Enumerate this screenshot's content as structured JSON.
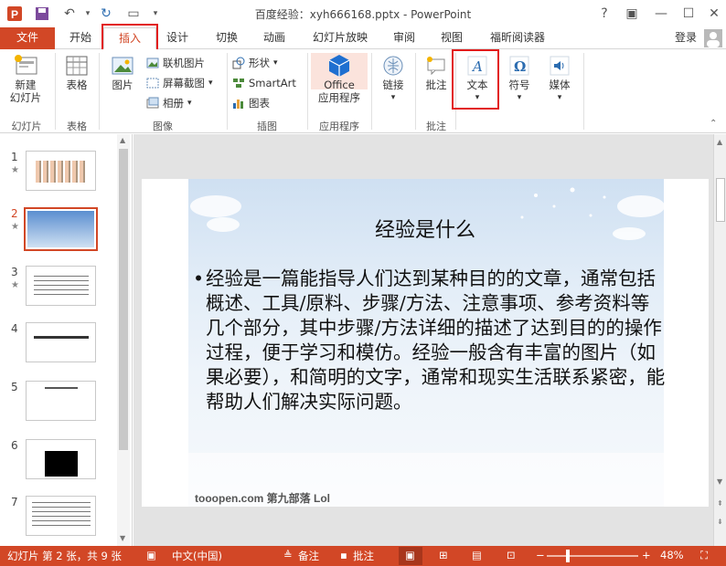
{
  "titlebar": {
    "title": "百度经验：xyh666168.pptx - PowerPoint",
    "help": "?",
    "minimize": "—",
    "close": "✕"
  },
  "tabs": {
    "file": "文件",
    "home": "开始",
    "insert": "插入",
    "design": "设计",
    "transitions": "切换",
    "animations": "动画",
    "slideshow": "幻灯片放映",
    "review": "审阅",
    "view": "视图",
    "foxit": "福昕阅读器",
    "login": "登录"
  },
  "ribbon": {
    "new_slide": "新建",
    "new_slide_2": "幻灯片",
    "table": "表格",
    "picture": "图片",
    "online_picture": "联机图片",
    "screenshot": "屏幕截图",
    "album": "相册",
    "shapes": "形状",
    "smartart": "SmartArt",
    "chart": "图表",
    "office_apps": "Office",
    "office_apps_2": "应用程序",
    "links": "链接",
    "comment": "批注",
    "text": "文本",
    "symbols": "符号",
    "media": "媒体",
    "groups": {
      "slides": "幻灯片",
      "tables": "表格",
      "images": "图像",
      "illustrations": "插图",
      "apps": "应用程序",
      "comments": "批注"
    }
  },
  "thumbnails": [
    {
      "num": "1",
      "star": "★"
    },
    {
      "num": "2",
      "star": "★"
    },
    {
      "num": "3",
      "star": "★"
    },
    {
      "num": "4",
      "star": ""
    },
    {
      "num": "5",
      "star": ""
    },
    {
      "num": "6",
      "star": ""
    },
    {
      "num": "7",
      "star": ""
    }
  ],
  "slide": {
    "title": "经验是什么",
    "body": "经验是一篇能指导人们达到某种目的的文章，通常包括概述、工具/原料、步骤/方法、注意事项、参考资料等几个部分，其中步骤/方法详细的描述了达到目的的操作过程，便于学习和模仿。经验一般含有丰富的图片（如果必要），和简明的文字，通常和现实生活联系紧密，能帮助人们解决实际问题。",
    "logo": "tooopen.com 第九部落 Lol"
  },
  "statusbar": {
    "slide_info": "幻灯片 第 2 张，共 9 张",
    "language": "中文(中国)",
    "notes": "备注",
    "comments": "批注",
    "zoom": "48%",
    "minus": "−",
    "plus": "+"
  },
  "colors": {
    "accent": "#d24726",
    "highlight": "#e21b1b"
  }
}
